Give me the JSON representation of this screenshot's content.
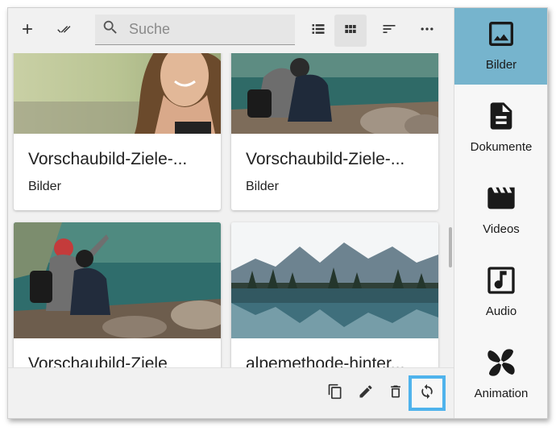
{
  "toolbar": {
    "add_icon": "plus-icon",
    "select_all_icon": "double-check-icon",
    "search_placeholder": "Suche",
    "search_value": "",
    "view_list_icon": "list-view-icon",
    "view_grid_icon": "grid-view-icon",
    "sort_icon": "sort-icon",
    "more_icon": "more-horizontal-icon"
  },
  "cards": [
    {
      "title": "Vorschaubild-Ziele-...",
      "category": "Bilder",
      "image": "woman-portrait-photo"
    },
    {
      "title": "Vorschaubild-Ziele-...",
      "category": "Bilder",
      "image": "couple-lake-photo"
    },
    {
      "title": "Vorschaubild-Ziele",
      "category": "",
      "image": "couple-pointing-lake-photo"
    },
    {
      "title": "alpemethode-hinter...",
      "category": "",
      "image": "mountain-lake-reflection-photo"
    }
  ],
  "actions": {
    "copy_icon": "copy-icon",
    "edit_icon": "pencil-icon",
    "delete_icon": "trash-icon",
    "replace_icon": "sync-icon"
  },
  "sidebar": {
    "items": [
      {
        "label": "Bilder",
        "icon": "image-icon",
        "active": true
      },
      {
        "label": "Dokumente",
        "icon": "document-icon",
        "active": false
      },
      {
        "label": "Videos",
        "icon": "clapperboard-icon",
        "active": false
      },
      {
        "label": "Audio",
        "icon": "music-note-icon",
        "active": false
      },
      {
        "label": "Animation",
        "icon": "pinwheel-icon",
        "active": false
      }
    ]
  },
  "colors": {
    "sidebar_active": "#76b4cd",
    "highlight_border": "#4fb3ec",
    "background": "#f1f1f1"
  }
}
